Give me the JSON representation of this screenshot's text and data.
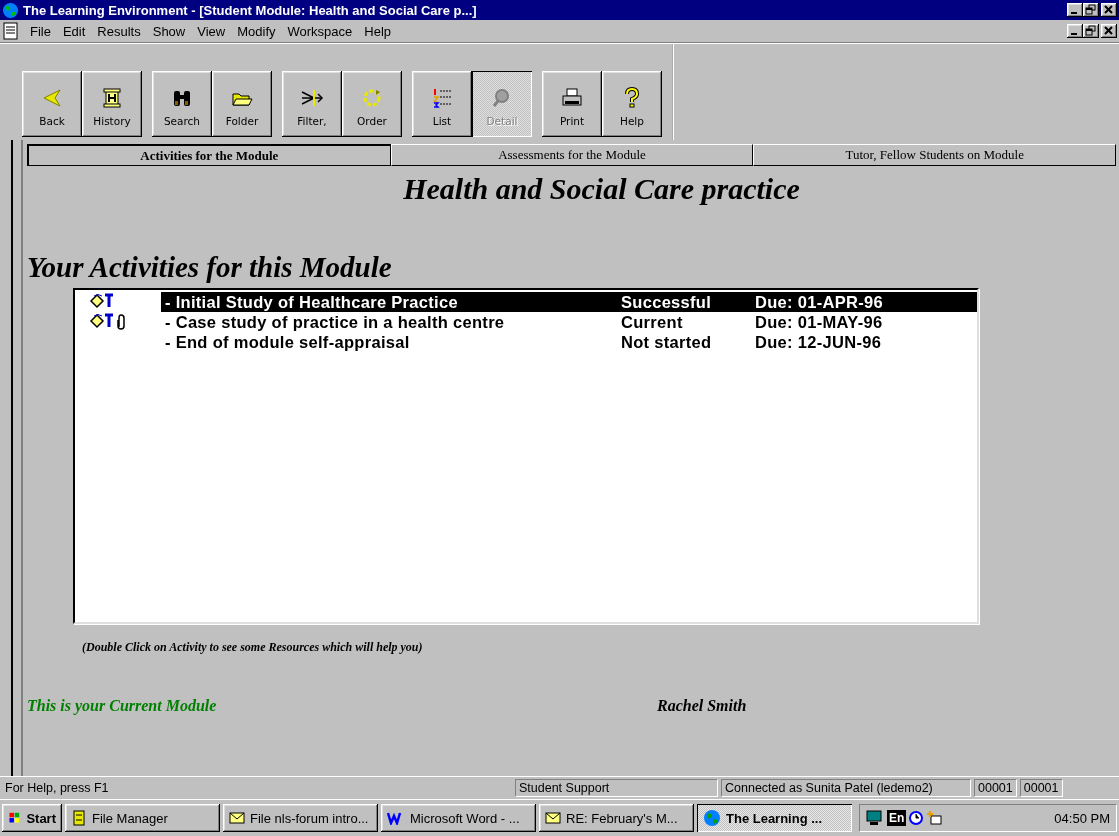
{
  "window": {
    "title": "The Learning Environment - [Student Module: Health and Social Care p...]"
  },
  "menu": [
    "File",
    "Edit",
    "Results",
    "Show",
    "View",
    "Modify",
    "Workspace",
    "Help"
  ],
  "toolbar": {
    "groups": [
      {
        "buttons": [
          {
            "kind": "back",
            "label": "Back",
            "disabled": false
          },
          {
            "kind": "history",
            "label": "History",
            "disabled": false
          }
        ]
      },
      {
        "buttons": [
          {
            "kind": "search",
            "label": "Search",
            "disabled": false
          },
          {
            "kind": "folder",
            "label": "Folder",
            "disabled": false
          }
        ]
      },
      {
        "buttons": [
          {
            "kind": "filter",
            "label": "Filter,",
            "disabled": false
          },
          {
            "kind": "order",
            "label": "Order",
            "disabled": false
          }
        ]
      },
      {
        "buttons": [
          {
            "kind": "list",
            "label": "List",
            "disabled": false
          },
          {
            "kind": "detail",
            "label": "Detail",
            "disabled": true
          }
        ]
      },
      {
        "buttons": [
          {
            "kind": "print",
            "label": "Print",
            "disabled": false
          },
          {
            "kind": "help",
            "label": "Help",
            "disabled": false
          }
        ]
      }
    ]
  },
  "tabs": [
    {
      "label": "Activities for the Module",
      "selected": true
    },
    {
      "label": "Assessments for the Module",
      "selected": false
    },
    {
      "label": "Tutor, Fellow Students on Module",
      "selected": false
    }
  ],
  "heading": "Health and Social Care practice",
  "subheading": "Your Activities for this Module",
  "activities": [
    {
      "title": "- Initial Study of Healthcare Practice",
      "status": "Successful",
      "due": "Due: 01-APR-96",
      "selected": true,
      "tagged": true,
      "attachment": false
    },
    {
      "title": "- Case study of practice in a health centre",
      "status": "Current",
      "due": "Due: 01-MAY-96",
      "selected": false,
      "tagged": true,
      "attachment": true
    },
    {
      "title": "- End of module self-appraisal",
      "status": "Not started",
      "due": "Due: 12-JUN-96",
      "selected": false,
      "tagged": false,
      "attachment": false
    }
  ],
  "hint": "(Double Click on Activity to see some Resources which will help you)",
  "module_note": "This is your Current Module",
  "student_name": "Rachel Smith",
  "status_bar": [
    "For Help, press F1",
    "Student Support",
    "Connected as Sunita Patel (ledemo2)",
    "00001",
    "00001"
  ],
  "taskbar": {
    "start": "Start",
    "tasks": [
      {
        "label": "File Manager",
        "kind": "files",
        "selected": false
      },
      {
        "label": "File nls-forum intro...",
        "kind": "mail",
        "selected": false
      },
      {
        "label": "Microsoft Word - ...",
        "kind": "word",
        "selected": false
      },
      {
        "label": "RE: February's M...",
        "kind": "mail",
        "selected": false
      },
      {
        "label": "The Learning ...",
        "kind": "globe",
        "selected": true
      }
    ],
    "tray_text": "En",
    "clock": "04:50 PM"
  }
}
